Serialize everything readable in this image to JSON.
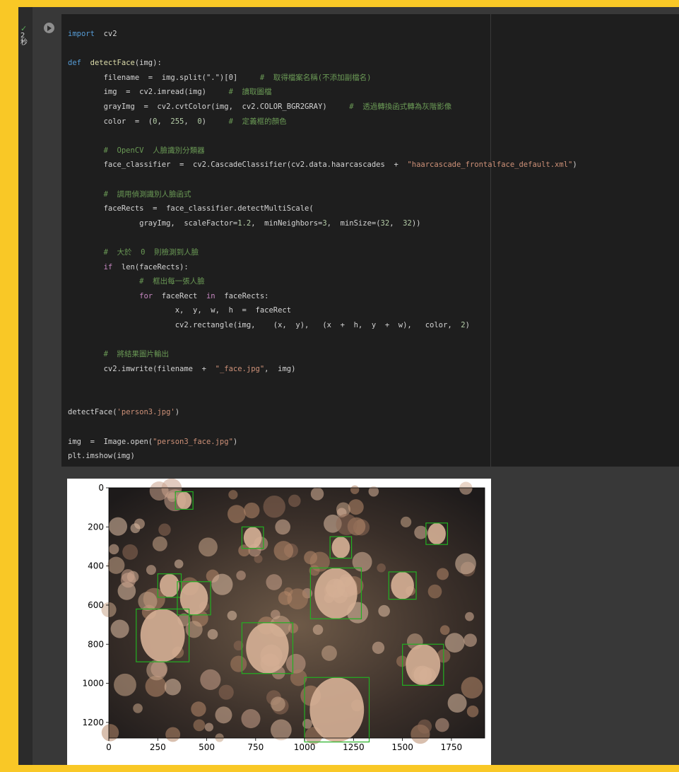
{
  "cell": {
    "status_check": "✓",
    "exec_time_value": "2",
    "exec_time_unit": "秒",
    "code_lines": [
      [
        [
          "kw2",
          "import"
        ],
        [
          "",
          "  cv2"
        ]
      ],
      [],
      [
        [
          "kw2",
          "def"
        ],
        [
          "",
          "  "
        ],
        [
          "fn",
          "detectFace"
        ],
        [
          "",
          "(img):"
        ]
      ],
      [
        [
          "",
          "        filename  =  img.split(\".\")[0]     "
        ],
        [
          "cm",
          "#  取得檔案名稱(不添加副檔名)"
        ]
      ],
      [
        [
          "",
          "        img  =  cv2.imread(img)     "
        ],
        [
          "cm",
          "#  讀取圖檔"
        ]
      ],
      [
        [
          "",
          "        grayImg  =  cv2.cvtColor(img,  cv2.COLOR_BGR2GRAY)     "
        ],
        [
          "cm",
          "#  透過轉換函式轉為灰階影像"
        ]
      ],
      [
        [
          "",
          "        color  =  ("
        ],
        [
          "num",
          "0"
        ],
        [
          "",
          ",  "
        ],
        [
          "num",
          "255"
        ],
        [
          "",
          ",  "
        ],
        [
          "num",
          "0"
        ],
        [
          "",
          ")     "
        ],
        [
          "cm",
          "#  定義框的顏色"
        ]
      ],
      [],
      [
        [
          "cm",
          "        #  OpenCV  人臉識別分類器"
        ]
      ],
      [
        [
          "",
          "        face_classifier  =  cv2.CascadeClassifier(cv2.data.haarcascades  +  "
        ],
        [
          "str",
          "\"haarcascade_frontalface_default.xml\""
        ],
        [
          "",
          ")"
        ]
      ],
      [],
      [
        [
          "cm",
          "        #  調用偵測識別人臉函式"
        ]
      ],
      [
        [
          "",
          "        faceRects  =  face_classifier.detectMultiScale("
        ]
      ],
      [
        [
          "",
          "                grayImg,  scaleFactor="
        ],
        [
          "num",
          "1.2"
        ],
        [
          "",
          ",  minNeighbors="
        ],
        [
          "num",
          "3"
        ],
        [
          "",
          ",  minSize=("
        ],
        [
          "num",
          "32"
        ],
        [
          "",
          ",  "
        ],
        [
          "num",
          "32"
        ],
        [
          "",
          "))"
        ]
      ],
      [],
      [
        [
          "cm",
          "        #  大於  0  則檢測到人臉"
        ]
      ],
      [
        [
          "",
          "        "
        ],
        [
          "kw",
          "if"
        ],
        [
          "",
          "  len(faceRects):"
        ]
      ],
      [
        [
          "cm",
          "                #  框出每一張人臉"
        ]
      ],
      [
        [
          "",
          "                "
        ],
        [
          "kw",
          "for"
        ],
        [
          "",
          "  faceRect  "
        ],
        [
          "kw",
          "in"
        ],
        [
          "",
          "  faceRects:"
        ]
      ],
      [
        [
          "",
          "                        x,  y,  w,  h  =  faceRect"
        ]
      ],
      [
        [
          "",
          "                        cv2.rectangle(img,    (x,  y),   (x  +  h,  y  +  w),   color,  "
        ],
        [
          "num",
          "2"
        ],
        [
          "",
          ")"
        ]
      ],
      [],
      [
        [
          "cm",
          "        #  將結果圖片輸出"
        ]
      ],
      [
        [
          "",
          "        cv2.imwrite(filename  +  "
        ],
        [
          "str",
          "\"_face.jpg\""
        ],
        [
          "",
          ",  img)"
        ]
      ],
      [],
      [],
      [
        [
          "",
          "detectFace("
        ],
        [
          "str",
          "'person3.jpg'"
        ],
        [
          "",
          ")"
        ]
      ],
      [],
      [
        [
          "",
          "img  =  Image.open("
        ],
        [
          "str",
          "\"person3_face.jpg\""
        ],
        [
          "",
          ")"
        ]
      ],
      [
        [
          "",
          "plt.imshow(img)"
        ]
      ],
      [
        [
          "",
          "plt.show()"
        ]
      ]
    ]
  },
  "colors": {
    "keyword": "#c586c0",
    "keyword_def": "#569cd6",
    "string": "#ce9178",
    "comment": "#6a9955",
    "number": "#b5cea8",
    "face_box": "#22b022"
  },
  "chart_data": {
    "type": "image",
    "x_ticks": [
      0,
      250,
      500,
      750,
      1000,
      1250,
      1500,
      1750
    ],
    "y_ticks": [
      0,
      200,
      400,
      600,
      800,
      1000,
      1200
    ],
    "xlim": [
      0,
      1920
    ],
    "ylim": [
      1280,
      0
    ],
    "face_boxes": [
      [
        340,
        20,
        90,
        90
      ],
      [
        1620,
        180,
        110,
        110
      ],
      [
        680,
        200,
        110,
        110
      ],
      [
        1130,
        250,
        110,
        110
      ],
      [
        1030,
        410,
        260,
        260
      ],
      [
        250,
        440,
        120,
        120
      ],
      [
        350,
        480,
        170,
        170
      ],
      [
        1430,
        430,
        140,
        140
      ],
      [
        140,
        620,
        270,
        270
      ],
      [
        680,
        690,
        260,
        260
      ],
      [
        1500,
        800,
        210,
        210
      ],
      [
        1000,
        970,
        330,
        330
      ]
    ]
  }
}
